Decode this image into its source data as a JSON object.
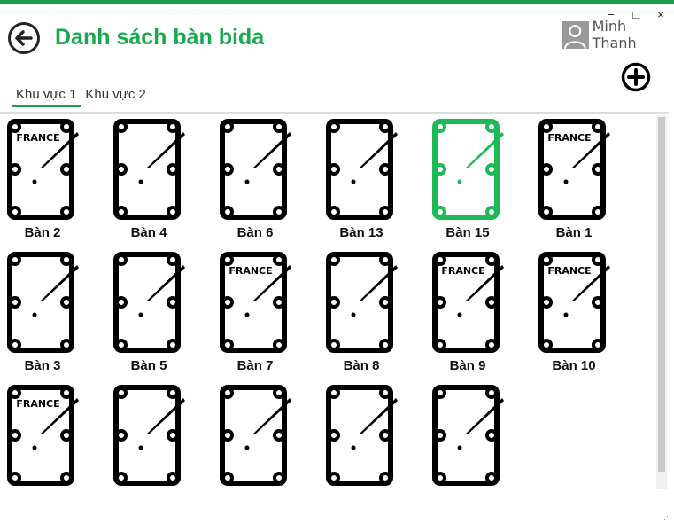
{
  "window": {
    "minimize": "−",
    "maximize": "□",
    "close": "×"
  },
  "header": {
    "title": "Danh sách bàn bida"
  },
  "user": {
    "name": "Minh Thanh"
  },
  "tabs": [
    {
      "label": "Khu vực 1",
      "active": true
    },
    {
      "label": "Khu vực 2",
      "active": false
    }
  ],
  "colors": {
    "accent": "#18a84e",
    "table": "#000000",
    "selected": "#1db954"
  },
  "tables": [
    {
      "label": "Bàn 2",
      "brand": "FRANCE",
      "selected": false
    },
    {
      "label": "Bàn 4",
      "brand": "",
      "selected": false
    },
    {
      "label": "Bàn 6",
      "brand": "",
      "selected": false
    },
    {
      "label": "Bàn 13",
      "brand": "",
      "selected": false
    },
    {
      "label": "Bàn 15",
      "brand": "",
      "selected": true
    },
    {
      "label": "Bàn 1",
      "brand": "FRANCE",
      "selected": false
    },
    {
      "label": "Bàn 3",
      "brand": "",
      "selected": false
    },
    {
      "label": "Bàn 5",
      "brand": "",
      "selected": false
    },
    {
      "label": "Bàn 7",
      "brand": "FRANCE",
      "selected": false
    },
    {
      "label": "Bàn 8",
      "brand": "",
      "selected": false
    },
    {
      "label": "Bàn 9",
      "brand": "FRANCE",
      "selected": false
    },
    {
      "label": "Bàn 10",
      "brand": "FRANCE",
      "selected": false
    },
    {
      "label": "",
      "brand": "FRANCE",
      "selected": false
    },
    {
      "label": "",
      "brand": "",
      "selected": false
    },
    {
      "label": "",
      "brand": "",
      "selected": false
    },
    {
      "label": "",
      "brand": "",
      "selected": false
    },
    {
      "label": "",
      "brand": "",
      "selected": false
    }
  ]
}
